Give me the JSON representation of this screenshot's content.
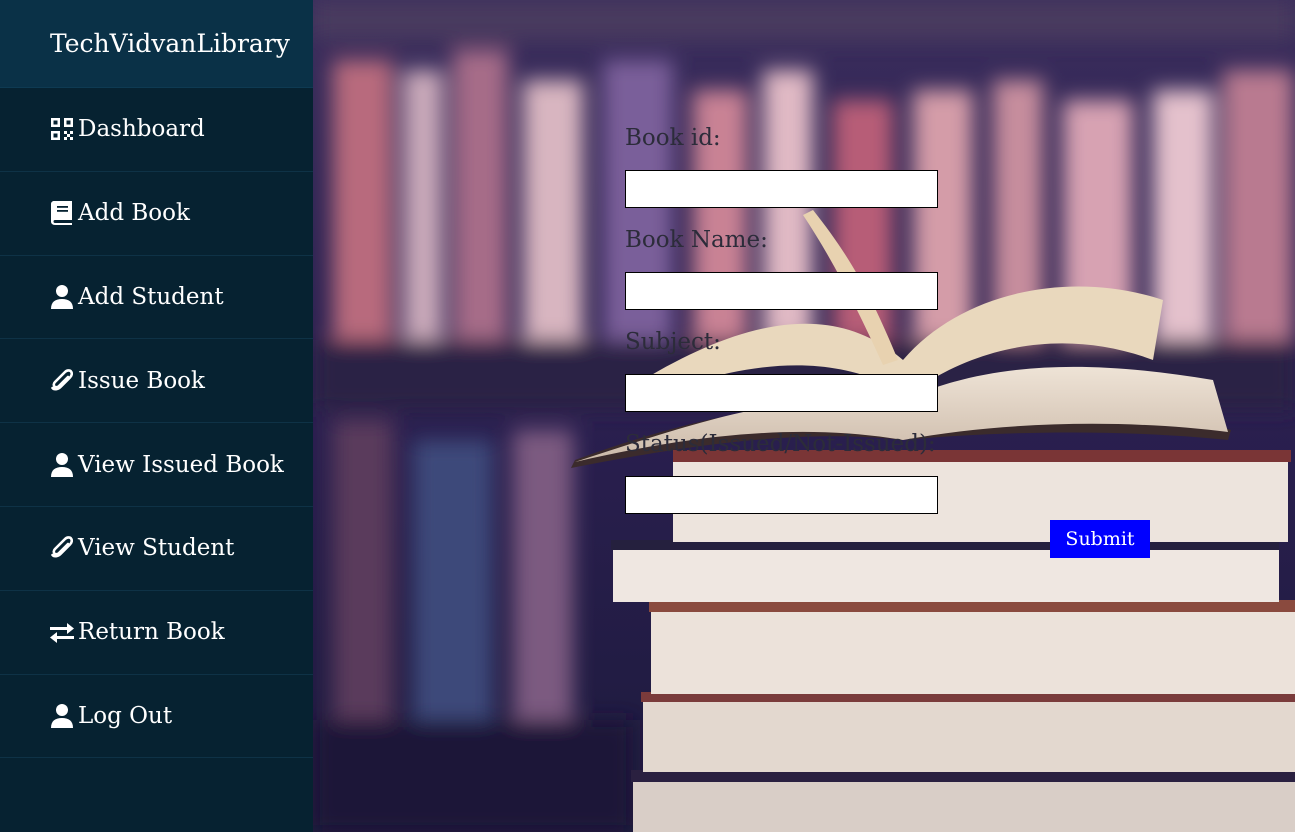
{
  "sidebar": {
    "brand": "TechVidvanLibrary",
    "items": [
      {
        "label": "Dashboard",
        "icon": "qrcode-icon"
      },
      {
        "label": "Add Book",
        "icon": "book-icon"
      },
      {
        "label": "Add Student",
        "icon": "user-icon"
      },
      {
        "label": "Issue Book",
        "icon": "paperclip-icon"
      },
      {
        "label": "View Issued Book",
        "icon": "user-icon"
      },
      {
        "label": "View Student",
        "icon": "paperclip-icon"
      },
      {
        "label": "Return Book",
        "icon": "exchange-icon"
      },
      {
        "label": "Log Out",
        "icon": "user-icon"
      }
    ]
  },
  "form": {
    "fields": [
      {
        "label": "Book id:",
        "value": ""
      },
      {
        "label": "Book Name:",
        "value": ""
      },
      {
        "label": "Subject:",
        "value": ""
      },
      {
        "label": "Status(Issued/Not-Issued):",
        "value": ""
      }
    ],
    "submit_label": "Submit"
  },
  "colors": {
    "sidebar_bg": "#062231",
    "brand_bg": "#0a3147",
    "submit_bg": "#0000ff"
  }
}
